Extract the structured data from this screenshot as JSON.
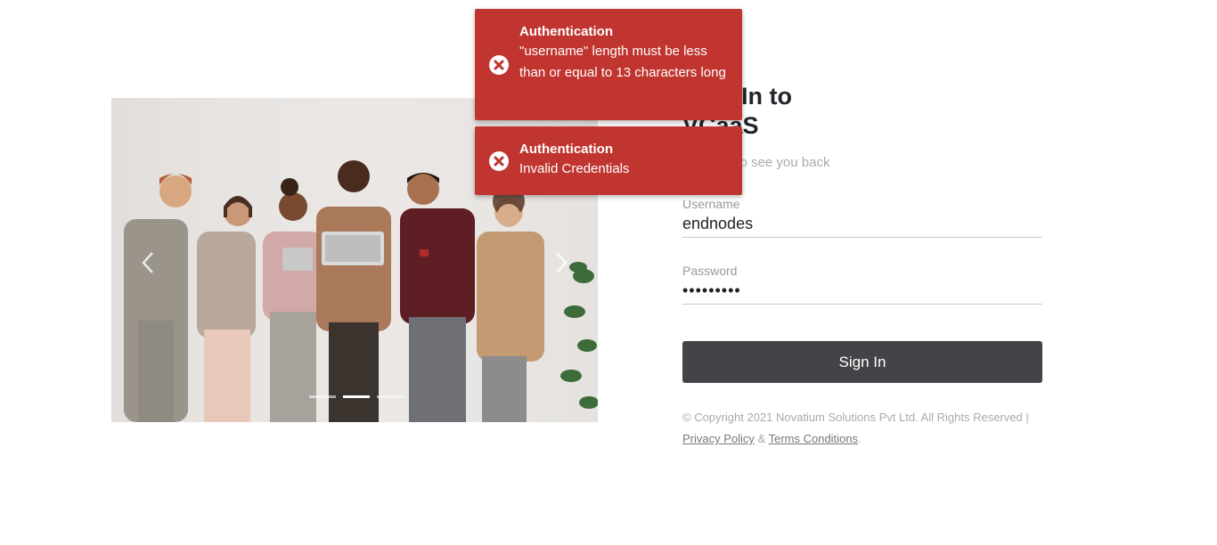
{
  "carousel": {
    "active_index": 1,
    "slide_count": 3
  },
  "login": {
    "heading_line1": "Sign In to",
    "heading_line2": "VCaaS",
    "subtitle": "It's good to see you back",
    "username_label": "Username",
    "username_value": "endnodes",
    "password_label": "Password",
    "password_value": "•••••••••",
    "signin_label": "Sign In"
  },
  "footer": {
    "copyright": "© Copyright 2021 Novatium Solutions Pvt Ltd. All Rights Reserved |",
    "privacy_link": "Privacy Policy",
    "ampersand": " & ",
    "terms_link": "Terms Conditions",
    "period": "."
  },
  "toasts": [
    {
      "title": "Authentication",
      "message": "\"username\" length must be less than or equal to 13 characters long",
      "icon": "error-circle-icon"
    },
    {
      "title": "Authentication",
      "message": "Invalid Credentials",
      "icon": "error-circle-icon"
    }
  ],
  "colors": {
    "toast_bg": "#c0352f",
    "signin_bg": "#444448"
  }
}
